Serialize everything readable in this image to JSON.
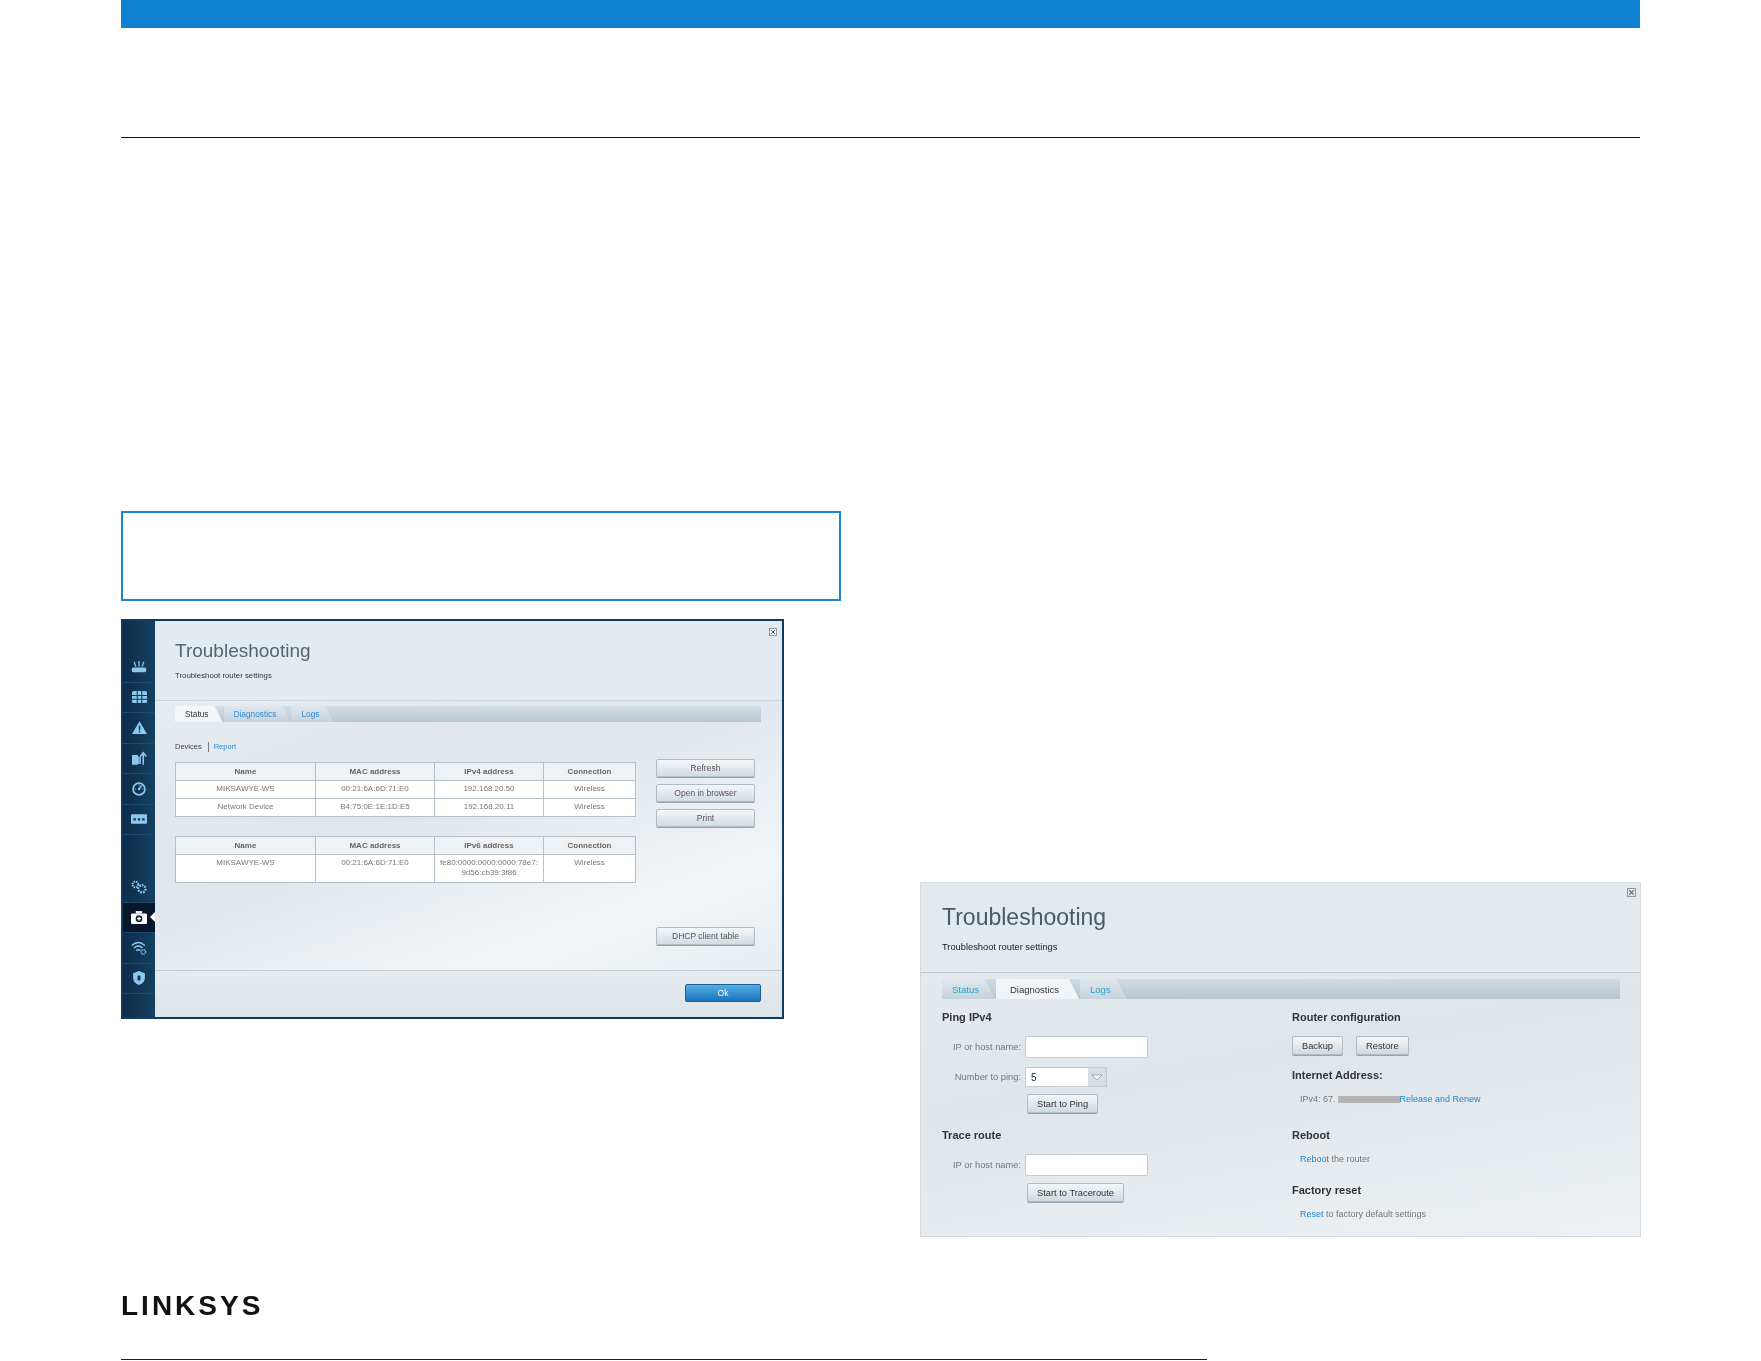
{
  "figure_1": {
    "sidebar": {
      "groups": [
        {
          "items": [
            {
              "selected": false
            },
            {
              "selected": false
            },
            {
              "selected": false
            },
            {
              "selected": false
            },
            {
              "selected": false
            },
            {
              "selected": false
            }
          ]
        },
        {
          "items": [
            {
              "selected": false
            },
            {
              "selected": true
            },
            {
              "selected": false
            },
            {
              "selected": false
            }
          ]
        }
      ]
    },
    "title": "Troubleshooting",
    "subtitle": "Troubleshoot router settings",
    "tabs": [
      {
        "label": "Status",
        "selected": true
      },
      {
        "label": "Diagnostics",
        "selected": false
      },
      {
        "label": "Logs",
        "selected": false
      }
    ],
    "sub_tabs": [
      {
        "label": "Devices",
        "selected": true
      },
      {
        "label": "Report",
        "selected": false
      }
    ],
    "tables": [
      {
        "columns": [
          "Name",
          "MAC address",
          "IPv4 address",
          "Connection"
        ],
        "rows": [
          [
            "MIKSAWYE-WS",
            "00:21:6A:6D:71:E0",
            "192.168.20.50",
            "Wireless"
          ],
          [
            "Network Device",
            "B4:75:0E:1E:1D:E5",
            "192.168.20.11",
            "Wireless"
          ]
        ]
      },
      {
        "columns": [
          "Name",
          "MAC address",
          "IPv6 address",
          "Connection"
        ],
        "rows": [
          [
            "MIKSAWYE-WS",
            "00:21:6A:6D:71:E0",
            "fe80:0000:0000:0000:78e7:9d56:cb39:3f86",
            "Wireless"
          ]
        ]
      }
    ],
    "buttons": [
      "Refresh",
      "Open in browser",
      "Print"
    ],
    "bottom_button": "DHCP client table",
    "footer_button": "Ok"
  },
  "figure_2": {
    "title": "Troubleshooting",
    "subtitle": "Troubleshoot router settings",
    "tabs": [
      {
        "label": "Status",
        "selected": false
      },
      {
        "label": "Diagnostics",
        "selected": true
      },
      {
        "label": "Logs",
        "selected": false
      }
    ],
    "ping": {
      "heading": "Ping IPv4",
      "fields": [
        {
          "label": "IP or host name:",
          "kind": "text"
        },
        {
          "label": "Number to ping:",
          "kind": "select",
          "value": "5"
        }
      ],
      "button": "Start to Ping"
    },
    "trace_route": {
      "heading": "Trace route",
      "fields": [
        {
          "label": "IP or host name:",
          "kind": "text"
        }
      ],
      "button": "Start to Traceroute"
    },
    "router_configuration": {
      "heading": "Router configuration",
      "buttons": [
        "Backup",
        "Restore"
      ]
    },
    "internet_address": {
      "heading": "Internet Address:",
      "ipv4": "IPv4: 67.",
      "link": "Release and Renew"
    },
    "reboot": {
      "heading": "Reboot",
      "link": "Reboot",
      "text": "the router"
    },
    "factory_reset": {
      "heading": "Factory reset",
      "link": "Reset",
      "text": "to factory default settings"
    }
  },
  "footer": {
    "logo": "LINKSYS"
  }
}
